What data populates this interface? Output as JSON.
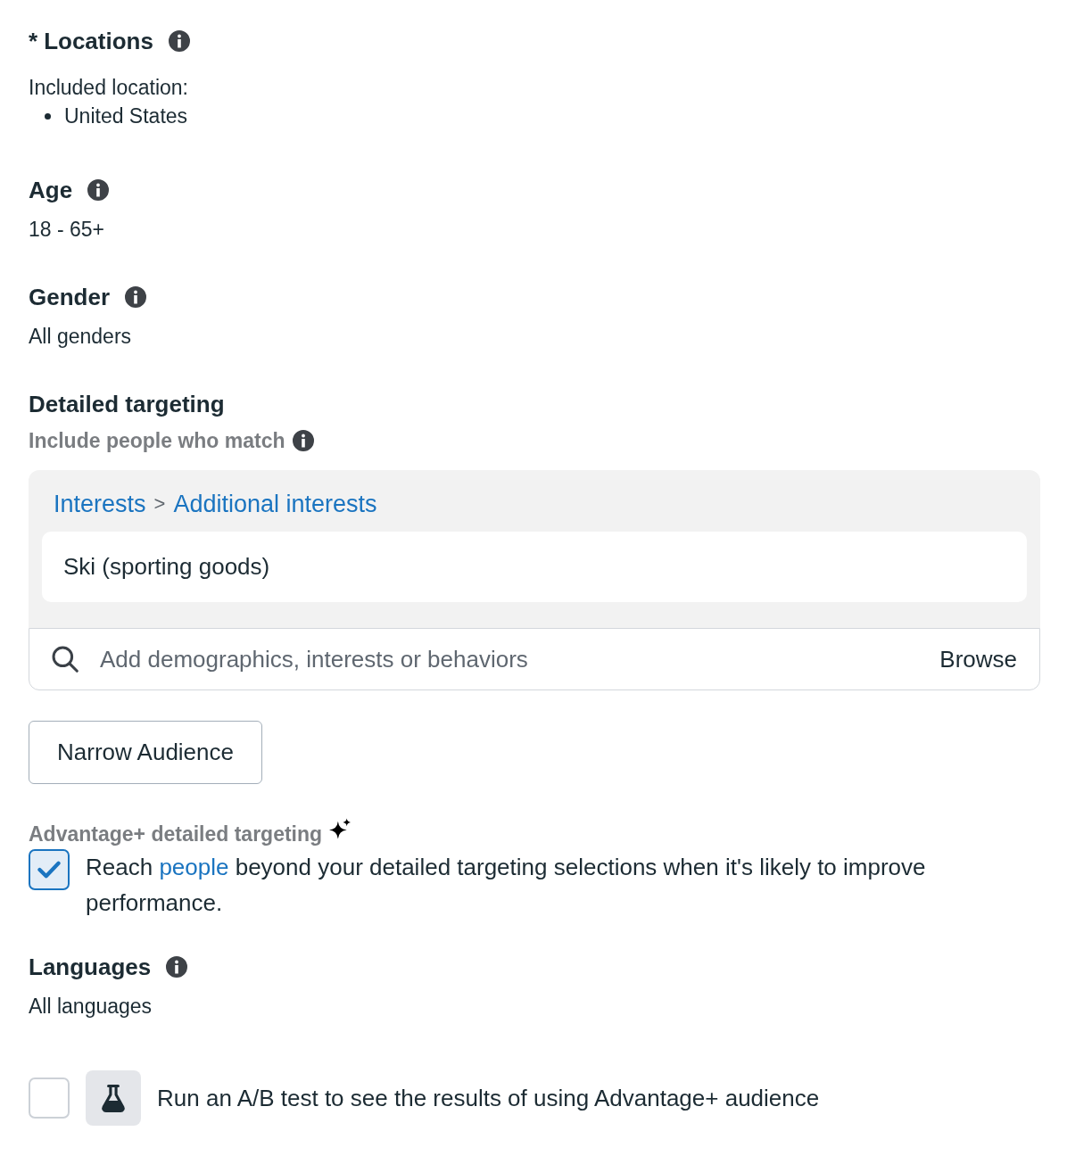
{
  "locations": {
    "required_mark": "*",
    "title": "Locations",
    "info": true,
    "label": "Included location:",
    "items": [
      "United States"
    ]
  },
  "age": {
    "title": "Age",
    "info": true,
    "value": "18 - 65+"
  },
  "gender": {
    "title": "Gender",
    "info": true,
    "value": "All genders"
  },
  "detailed_targeting": {
    "title": "Detailed targeting",
    "info": false,
    "subtitle": "Include people who match",
    "subtitle_info": true,
    "breadcrumb": {
      "items": [
        "Interests",
        "Additional interests"
      ],
      "separator": ">"
    },
    "selections": [
      "Ski (sporting goods)"
    ],
    "search": {
      "placeholder": "Add demographics, interests or behaviors",
      "browse": "Browse"
    },
    "narrow_button": "Narrow Audience"
  },
  "advantage": {
    "label": "Advantage+ detailed targeting",
    "checked": true,
    "text_before": "Reach ",
    "link": "people",
    "text_after": " beyond your detailed targeting selections when it's likely to improve performance."
  },
  "languages": {
    "title": "Languages",
    "info": true,
    "value": "All languages"
  },
  "ab_test": {
    "checked": false,
    "label": "Run an A/B test to see the results of using Advantage+ audience"
  }
}
